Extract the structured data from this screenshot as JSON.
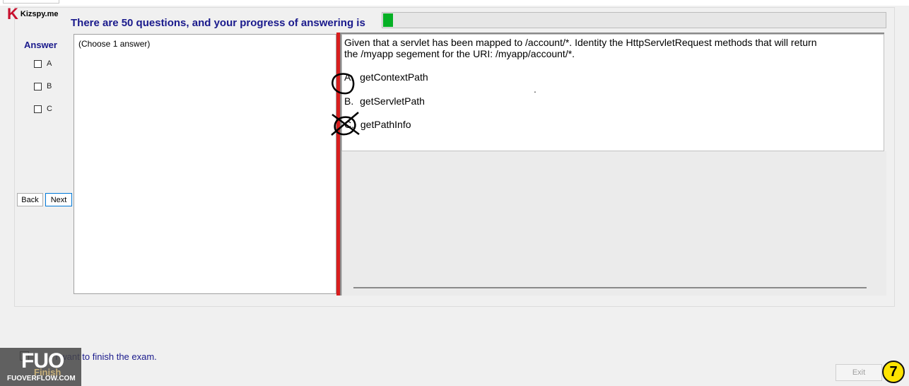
{
  "app": {
    "logo_letter": "K",
    "logo_text": "Kizspy.me"
  },
  "header": {
    "text": "There are 50 questions, and your progress of answering is",
    "progress_fraction": 0.02,
    "progress_color": "#06b025"
  },
  "answer_panel": {
    "title": "Answer",
    "options": [
      "A",
      "B",
      "C"
    ],
    "back_label": "Back",
    "next_label": "Next"
  },
  "choose_text": "(Choose 1 answer)",
  "question": {
    "line1": "Given that a servlet has been mapped to /account/*. Identity the HttpServletRequest methods that will return",
    "line2": "the /myapp segement for the URI: /myapp/account/*.",
    "options": [
      {
        "letter": "A.",
        "text": "getContextPath"
      },
      {
        "letter": "B.",
        "text": "getServletPath"
      },
      {
        "letter": "C.",
        "text": "getPathInfo"
      }
    ],
    "stray_mark": "."
  },
  "footer": {
    "finish_text": "I want to finish the exam.",
    "finish_button": "Finish",
    "exit_label": "Exit",
    "page_number": "7"
  },
  "watermark": {
    "logo": "FUO",
    "text": "FUOVERFLOW.COM"
  },
  "colors": {
    "accent": "#1a1a8c",
    "splitter": "#d81e1e",
    "brand": "#c8102e",
    "badge": "#ffe400"
  }
}
